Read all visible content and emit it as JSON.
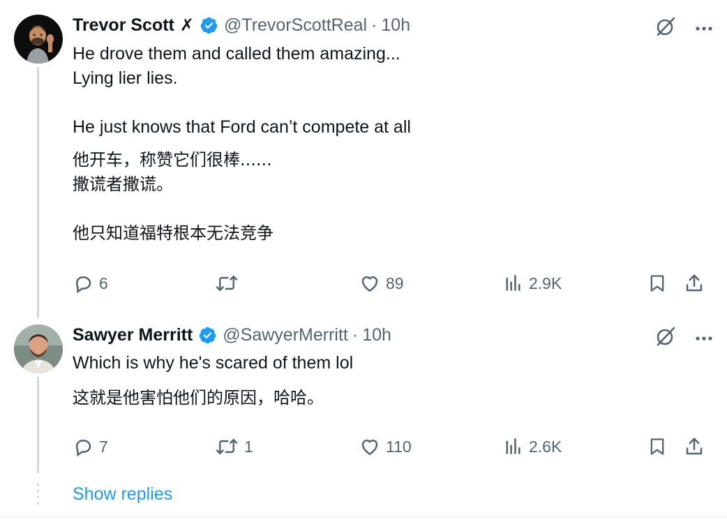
{
  "tweets": [
    {
      "author": {
        "name": "Trevor Scott",
        "name_suffix": "✗",
        "handle": "@TrevorScottReal",
        "time": "10h",
        "verified": true,
        "avatar_icon": "waving-man-emoji-avatar"
      },
      "text": "He drove them and called them amazing...\nLying lier lies.\n\nHe just knows that Ford can’t compete at all",
      "translation": "他开车，称赞它们很棒......\n撒谎者撒谎。\n\n他只知道福特根本无法竞争",
      "stats": {
        "replies": "6",
        "retweets": "",
        "likes": "89",
        "views": "2.9K"
      }
    },
    {
      "author": {
        "name": "Sawyer Merritt",
        "handle": "@SawyerMerritt",
        "time": "10h",
        "verified": true,
        "avatar_icon": "bearded-man-photo-avatar"
      },
      "text": "Which is why he's scared of them lol",
      "translation": "这就是他害怕他们的原因，哈哈。",
      "stats": {
        "replies": "7",
        "retweets": "1",
        "likes": "110",
        "views": "2.6K"
      }
    }
  ],
  "show_replies": "Show replies",
  "separator": "·",
  "colors": {
    "text": "#0f1419",
    "muted": "#536471",
    "accent": "#1d9bf0",
    "thread_line": "#cfd9de"
  },
  "icons": [
    "grok-icon",
    "more-icon",
    "reply-icon",
    "retweet-icon",
    "like-icon",
    "views-icon",
    "bookmark-icon",
    "share-icon",
    "verified-badge-icon"
  ]
}
